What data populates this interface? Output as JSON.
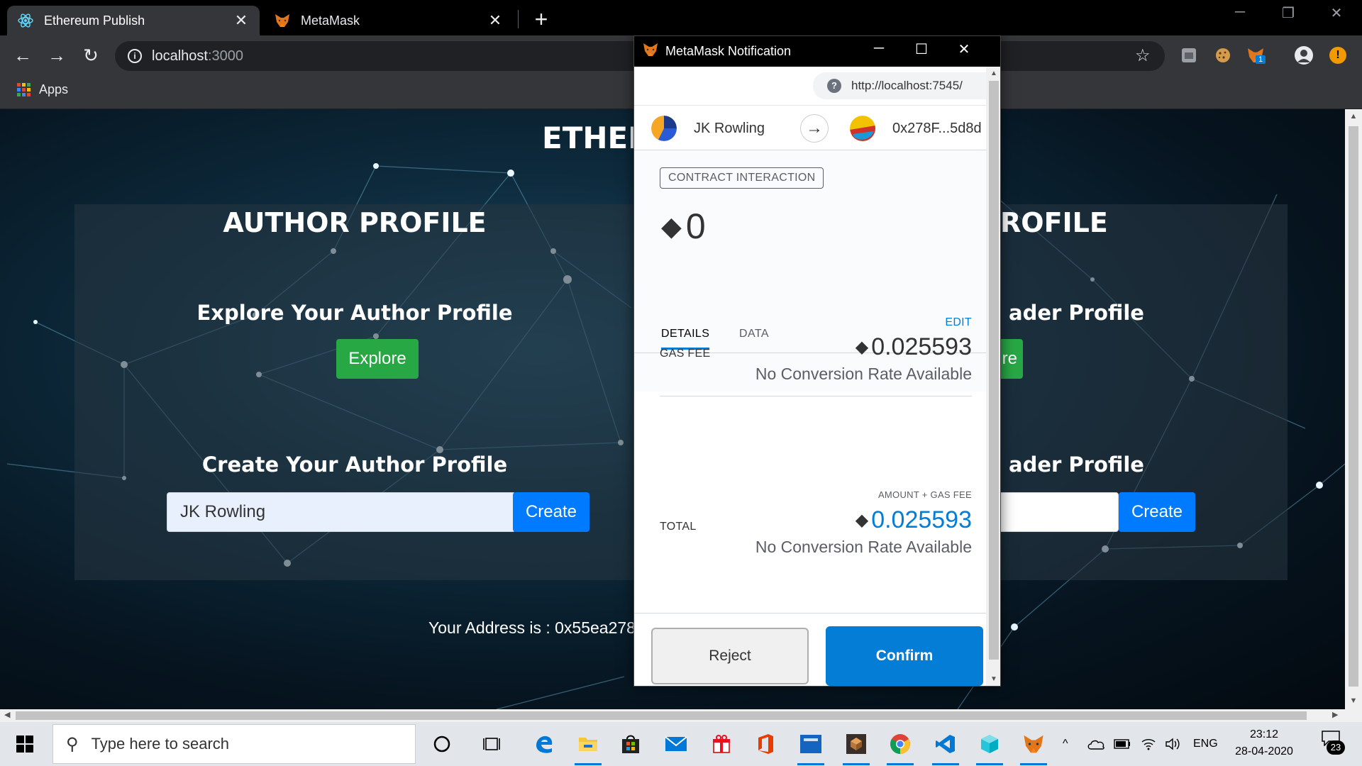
{
  "browser": {
    "tabs": [
      {
        "title": "Ethereum Publish",
        "icon": "react-icon",
        "active": true
      },
      {
        "title": "MetaMask",
        "icon": "metamask-fox-icon",
        "active": false
      }
    ],
    "new_tab": "+",
    "window_controls": {
      "minimize": "─",
      "restore": "❐",
      "close": "✕"
    },
    "url_host": "localhost",
    "url_port": ":3000",
    "bookmarks": {
      "apps_label": "Apps"
    },
    "extensions": [
      "extension-icon",
      "cookie-icon",
      "metamask-fox-icon",
      "profile-avatar-icon",
      "alert-icon"
    ],
    "metamask_badge": "1",
    "alert_glyph": "!"
  },
  "page": {
    "title": "ETHERI",
    "author_panel": {
      "heading": "AUTHOR PROFILE",
      "explore_heading": "Explore Your Author Profile",
      "explore_button": "Explore",
      "create_heading": "Create Your Author Profile",
      "name_input_value": "JK Rowling",
      "create_button": "Create"
    },
    "reader_panel": {
      "heading": "ROFILE",
      "explore_heading": "ader Profile",
      "explore_button": "re",
      "create_heading": "ader Profile",
      "name_input_value": "",
      "create_button": "Create"
    },
    "address_text": "Your Address is : 0x55ea278"
  },
  "metamask": {
    "window_title": "MetaMask Notification",
    "origin": "http://localhost:7545/",
    "from_name": "JK Rowling",
    "to_address": "0x278F...5d8d",
    "arrow": "→",
    "badge": "CONTRACT INTERACTION",
    "amount": "0",
    "tabs": [
      "DETAILS",
      "DATA"
    ],
    "active_tab": "DETAILS",
    "edit_label": "EDIT",
    "gas_fee_label": "GAS FEE",
    "gas_fee_value": "0.025593",
    "gas_fee_sub": "No Conversion Rate Available",
    "total_caption": "AMOUNT + GAS FEE",
    "total_label": "TOTAL",
    "total_value": "0.025593",
    "total_sub": "No Conversion Rate Available",
    "reject_button": "Reject",
    "confirm_button": "Confirm",
    "accent_color": "#037dd6"
  },
  "taskbar": {
    "search_placeholder": "Type here to search",
    "language": "ENG",
    "time": "23:12",
    "date": "28-04-2020",
    "notification_count": "23",
    "pinned_icons": [
      "cortana-icon",
      "task-view-icon",
      "edge-icon",
      "file-explorer-icon",
      "store-icon",
      "mail-icon",
      "gift-icon",
      "office-icon",
      "calculator-icon",
      "box-app-icon",
      "chrome-icon",
      "vscode-icon",
      "cube-app-icon",
      "metamask-fox-icon"
    ]
  }
}
